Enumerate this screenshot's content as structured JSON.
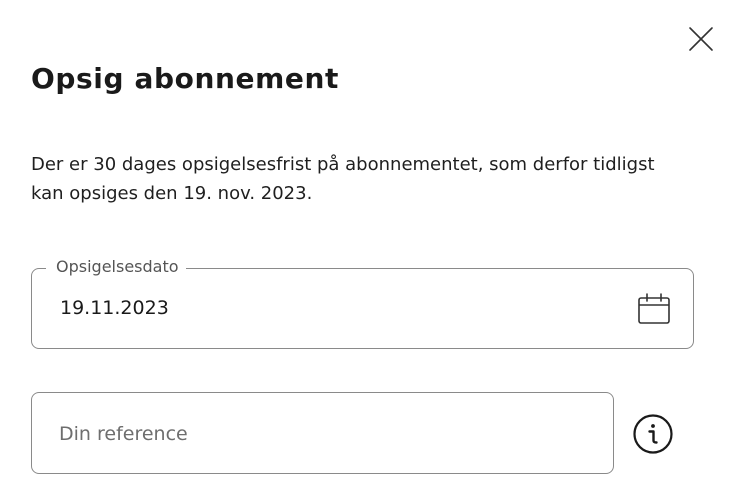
{
  "dialog": {
    "title": "Opsig abonnement",
    "description": "Der er 30 dages opsigelsesfrist på abonnementet, som derfor tidligst kan opsiges den 19. nov. 2023.",
    "close_icon": "close-icon"
  },
  "date_field": {
    "label": "Opsigelsesdato",
    "value": "19.11.2023",
    "icon": "calendar-icon"
  },
  "reference_field": {
    "placeholder": "Din reference",
    "value": "",
    "info_icon": "info-icon"
  },
  "colors": {
    "text": "#1a1a1a",
    "border": "#8a8a8a",
    "label": "#555555",
    "placeholder": "#6e6e6e",
    "background": "#ffffff"
  }
}
